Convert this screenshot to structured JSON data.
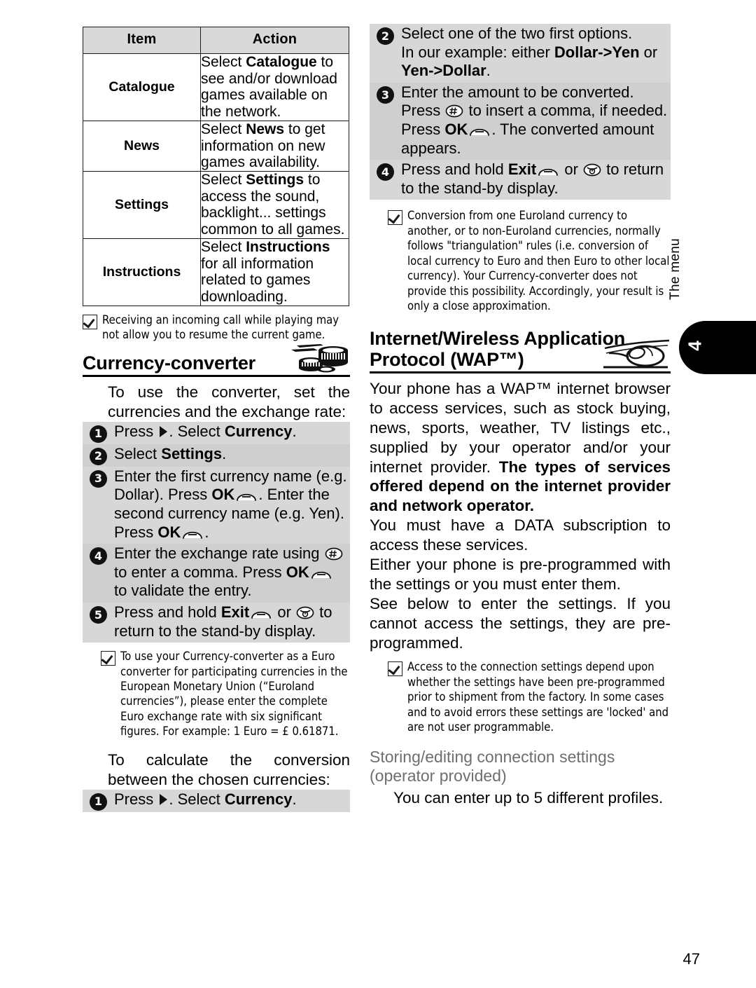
{
  "page": {
    "number": "47",
    "side_tab_label": "The menu",
    "side_tab_number": "4"
  },
  "left_column": {
    "table": {
      "headers": [
        "Item",
        "Action"
      ],
      "rows": [
        {
          "item": "Catalogue",
          "action_pre": "Select ",
          "action_bold": "Catalogue",
          "action_post": " to see and/or download games available on the network."
        },
        {
          "item": "News",
          "action_pre": "Select ",
          "action_bold": "News",
          "action_post": " to get information on new games availability."
        },
        {
          "item": "Settings",
          "action_pre": "Select ",
          "action_bold": "Settings",
          "action_post": " to access the sound, backlight... settings common to all games."
        },
        {
          "item": "Instructions",
          "action_pre": "Select ",
          "action_bold": "Instructions",
          "action_post": " for all information related to games downloading."
        }
      ]
    },
    "note_games": "Receiving an incoming call while playing may not allow you to resume the current game.",
    "heading_currency": "Currency-converter",
    "intro_currency": "To use the converter, set the currencies and the exchange rate:",
    "setup_steps": [
      {
        "num": "1",
        "parts": [
          {
            "t": "text",
            "v": "Press "
          },
          {
            "t": "icon",
            "v": "nav-right-arrow-icon"
          },
          {
            "t": "text",
            "v": ". Select "
          },
          {
            "t": "bold",
            "v": "Currency"
          },
          {
            "t": "text",
            "v": "."
          }
        ]
      },
      {
        "num": "2",
        "parts": [
          {
            "t": "text",
            "v": "Select "
          },
          {
            "t": "bold",
            "v": "Settings"
          },
          {
            "t": "text",
            "v": "."
          }
        ]
      },
      {
        "num": "3",
        "parts": [
          {
            "t": "text",
            "v": "Enter the first currency name (e.g. Dollar). Press "
          },
          {
            "t": "bold",
            "v": "OK"
          },
          {
            "t": "icon",
            "v": "soft-key-icon"
          },
          {
            "t": "text",
            "v": ". Enter the second currency name (e.g. Yen). Press "
          },
          {
            "t": "bold",
            "v": "OK"
          },
          {
            "t": "icon",
            "v": "soft-key-icon"
          },
          {
            "t": "text",
            "v": "."
          }
        ]
      },
      {
        "num": "4",
        "parts": [
          {
            "t": "text",
            "v": "Enter the exchange rate using "
          },
          {
            "t": "icon",
            "v": "hash-key-icon"
          },
          {
            "t": "text",
            "v": " to enter a comma. Press "
          },
          {
            "t": "bold",
            "v": "OK"
          },
          {
            "t": "icon",
            "v": "soft-key-icon"
          },
          {
            "t": "text",
            "v": " to validate the entry."
          }
        ]
      },
      {
        "num": "5",
        "parts": [
          {
            "t": "text",
            "v": "Press and hold "
          },
          {
            "t": "bold",
            "v": "Exit"
          },
          {
            "t": "icon",
            "v": "soft-key-icon"
          },
          {
            "t": "text",
            "v": " or "
          },
          {
            "t": "icon",
            "v": "power-key-icon"
          },
          {
            "t": "text",
            "v": " to return to the stand-by display."
          }
        ]
      }
    ],
    "note_euro": "To use your Currency-converter as a Euro converter for participating currencies in the European Monetary Union (“Euroland currencies”), please enter the complete Euro exchange rate with six significant figures. For example: 1 Euro = £ 0.61871.",
    "intro_calculate": "To calculate the conversion between the chosen currencies:",
    "calc_steps": [
      {
        "num": "1",
        "parts": [
          {
            "t": "text",
            "v": "Press "
          },
          {
            "t": "icon",
            "v": "nav-right-arrow-icon"
          },
          {
            "t": "text",
            "v": ". Select "
          },
          {
            "t": "bold",
            "v": "Currency"
          },
          {
            "t": "text",
            "v": "."
          }
        ]
      }
    ]
  },
  "right_column": {
    "calc_steps_cont": [
      {
        "num": "2",
        "parts": [
          {
            "t": "text",
            "v": "Select one of the two first options."
          },
          {
            "t": "br",
            "v": ""
          },
          {
            "t": "text",
            "v": "In our example: either "
          },
          {
            "t": "bold",
            "v": "Dollar->Yen"
          },
          {
            "t": "text",
            "v": " or "
          },
          {
            "t": "bold",
            "v": "Yen->Dollar"
          },
          {
            "t": "text",
            "v": "."
          }
        ]
      },
      {
        "num": "3",
        "parts": [
          {
            "t": "text",
            "v": "Enter the amount to be converted. Press "
          },
          {
            "t": "icon",
            "v": "hash-key-icon"
          },
          {
            "t": "text",
            "v": " to insert a comma, if needed. Press "
          },
          {
            "t": "bold",
            "v": "OK"
          },
          {
            "t": "icon",
            "v": "soft-key-icon"
          },
          {
            "t": "text",
            "v": ". The converted amount appears."
          }
        ]
      },
      {
        "num": "4",
        "parts": [
          {
            "t": "text",
            "v": "Press and hold "
          },
          {
            "t": "bold",
            "v": "Exit"
          },
          {
            "t": "icon",
            "v": "soft-key-icon"
          },
          {
            "t": "text",
            "v": " or "
          },
          {
            "t": "icon",
            "v": "power-key-icon"
          },
          {
            "t": "text",
            "v": " to return to the stand-by display."
          }
        ]
      }
    ],
    "note_triangulation": "Conversion from one Euroland currency to another, or to non-Euroland currencies, normally follows \"triangulation\" rules (i.e. conversion of local currency to Euro and then Euro to other local currency). Your Currency-converter does not provide this possibility. Accordingly, your result is only a close approximation.",
    "heading_wap": "Internet/Wireless Application Protocol (WAP™)",
    "para_1_pre": "Your phone has a WAP™ internet browser to access services, such as stock buying, news, sports, weather, TV listings etc., supplied by your operator and/or your internet provider. ",
    "para_1_bold": "The types of services offered depend on the internet provider and network operator.",
    "para_2": "You must have a DATA subscription to access these services.",
    "para_3": "Either your phone is pre-programmed with the settings or you must enter them.",
    "para_4": "See below to enter the settings. If you cannot access the settings, they are pre-programmed.",
    "note_access": "Access to the connection settings depend upon whether the settings have been pre-programmed prior to shipment from the factory. In some cases and to avoid errors these settings are 'locked' and are not user programmable.",
    "heading_storing": "Storing/editing connection settings (operator provided)",
    "para_profiles": "You can enter up to 5 different profiles."
  }
}
